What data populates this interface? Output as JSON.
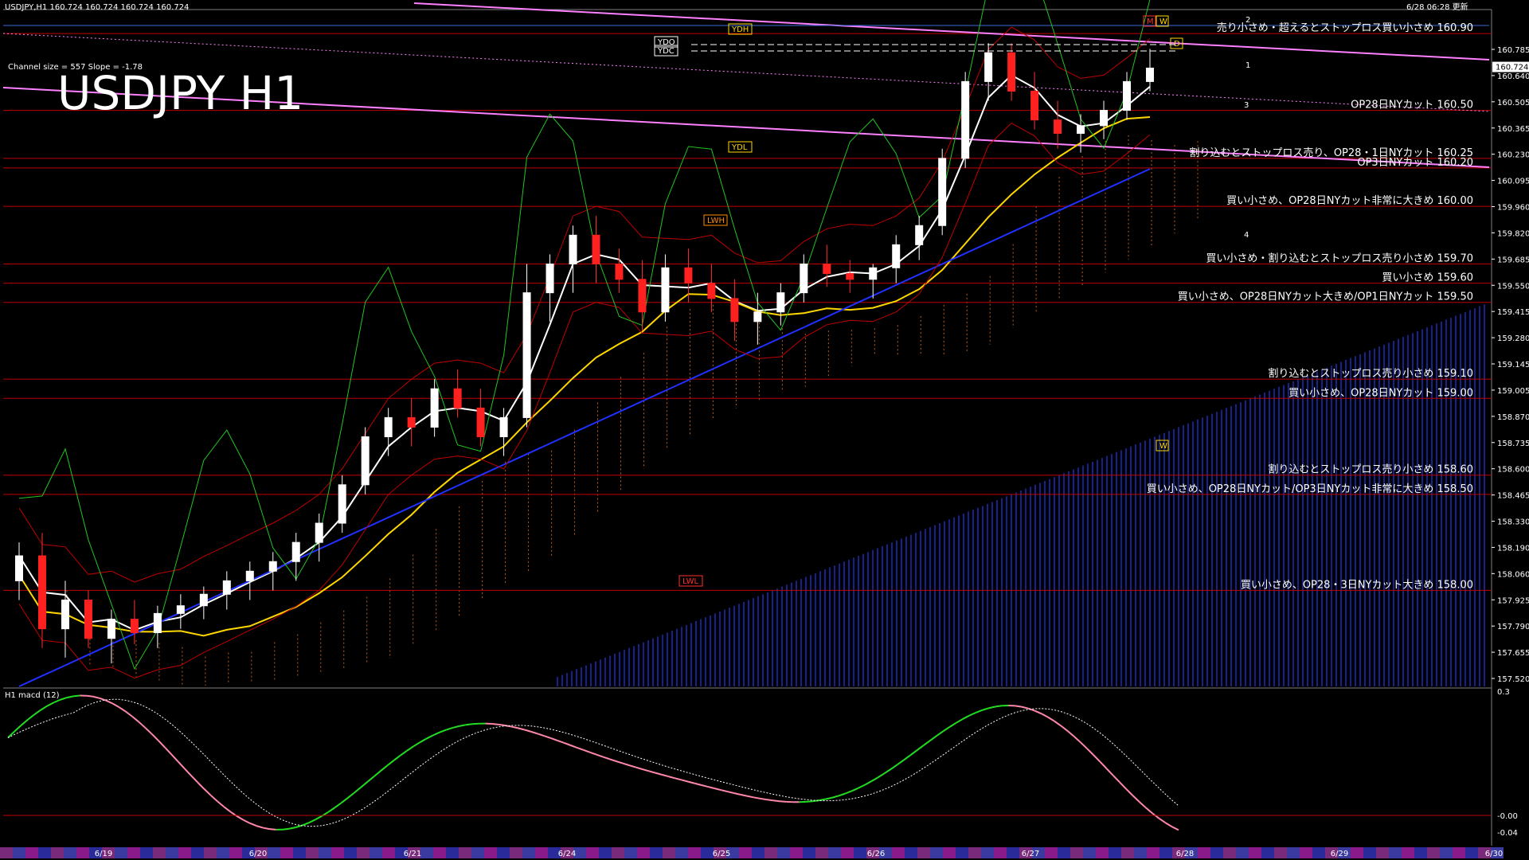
{
  "header": {
    "symbol_line": "USDJPY,H1  160.724 160.724 160.724 160.724",
    "updated": "6/28 06:28 更新",
    "channel_info": "Channel size = 557 Slope = -1.78",
    "subwindow_label": "H1  macd (12)"
  },
  "chart_data": {
    "type": "candlestick",
    "title": "USDJPY H1",
    "price_axis": {
      "range": [
        157.5,
        161.0
      ],
      "ticks": [
        "160.785",
        "160.640",
        "160.505",
        "160.365",
        "160.230",
        "160.095",
        "159.960",
        "159.820",
        "159.685",
        "159.550",
        "159.415",
        "159.280",
        "159.145",
        "159.005",
        "158.870",
        "158.735",
        "158.600",
        "158.465",
        "158.330",
        "158.190",
        "158.060",
        "157.925",
        "157.790",
        "157.655",
        "157.520"
      ],
      "current_price": "160.724"
    },
    "macd_axis": {
      "range": [
        -0.05,
        0.3
      ],
      "ticks": [
        "0.3",
        "-0.00",
        "-0.04"
      ]
    },
    "date_labels": [
      "6/19",
      "6/20",
      "6/21",
      "6/24",
      "6/25",
      "6/26",
      "6/27",
      "6/28",
      "6/29",
      "6/30"
    ],
    "level_labels": [
      "YDH",
      "YDL",
      "YDO",
      "YDC",
      "LWH",
      "LWL",
      "M",
      "W",
      "D",
      "W",
      "1",
      "2",
      "3",
      "4"
    ],
    "price_levels": [
      {
        "price": 160.9,
        "text": "売り小さめ・超えるとストップロス買い小さめ 160.90"
      },
      {
        "price": 160.5,
        "text": "OP28日NYカット 160.50"
      },
      {
        "price": 160.25,
        "text": "割り込むとストップロス売り、OP28・1日NYカット 160.25"
      },
      {
        "price": 160.2,
        "text": "OP3日NYカット 160.20"
      },
      {
        "price": 160.0,
        "text": "買い小さめ、OP28日NYカット非常に大きめ 160.00"
      },
      {
        "price": 159.7,
        "text": "買い小さめ・割り込むとストップロス売り小さめ 159.70"
      },
      {
        "price": 159.6,
        "text": "買い小さめ 159.60"
      },
      {
        "price": 159.5,
        "text": "買い小さめ、OP28日NYカット大きめ/OP1日NYカット 159.50"
      },
      {
        "price": 159.1,
        "text": "割り込むとストップロス売り小さめ 159.10"
      },
      {
        "price": 159.0,
        "text": "買い小さめ、OP28日NYカット 159.00"
      },
      {
        "price": 158.6,
        "text": "割り込むとストップロス売り小さめ 158.60"
      },
      {
        "price": 158.5,
        "text": "買い小さめ、OP28日NYカット/OP3日NYカット非常に大きめ 158.50"
      },
      {
        "price": 158.0,
        "text": "買い小さめ、OP28・3日NYカット大きめ 158.00"
      }
    ],
    "candles": [
      [
        158.05,
        158.25,
        157.95,
        158.18
      ],
      [
        158.18,
        158.3,
        157.7,
        157.8
      ],
      [
        157.8,
        158.05,
        157.65,
        157.95
      ],
      [
        157.95,
        158.0,
        157.7,
        157.75
      ],
      [
        157.75,
        157.9,
        157.62,
        157.85
      ],
      [
        157.85,
        157.95,
        157.72,
        157.78
      ],
      [
        157.78,
        157.92,
        157.7,
        157.88
      ],
      [
        157.88,
        157.98,
        157.8,
        157.92
      ],
      [
        157.92,
        158.02,
        157.85,
        157.98
      ],
      [
        157.98,
        158.1,
        157.9,
        158.05
      ],
      [
        158.05,
        158.15,
        157.95,
        158.1
      ],
      [
        158.1,
        158.2,
        158.0,
        158.15
      ],
      [
        158.15,
        158.3,
        158.05,
        158.25
      ],
      [
        158.25,
        158.4,
        158.15,
        158.35
      ],
      [
        158.35,
        158.6,
        158.3,
        158.55
      ],
      [
        158.55,
        158.85,
        158.5,
        158.8
      ],
      [
        158.8,
        158.95,
        158.7,
        158.9
      ],
      [
        158.9,
        159.0,
        158.75,
        158.85
      ],
      [
        158.85,
        159.1,
        158.8,
        159.05
      ],
      [
        159.05,
        159.15,
        158.9,
        158.95
      ],
      [
        158.95,
        159.05,
        158.75,
        158.8
      ],
      [
        158.8,
        158.95,
        158.7,
        158.9
      ],
      [
        158.9,
        159.7,
        158.85,
        159.55
      ],
      [
        159.55,
        159.75,
        159.4,
        159.7
      ],
      [
        159.7,
        159.9,
        159.55,
        159.85
      ],
      [
        159.85,
        159.95,
        159.6,
        159.7
      ],
      [
        159.7,
        159.78,
        159.55,
        159.62
      ],
      [
        159.62,
        159.72,
        159.35,
        159.45
      ],
      [
        159.45,
        159.75,
        159.4,
        159.68
      ],
      [
        159.68,
        159.78,
        159.5,
        159.6
      ],
      [
        159.6,
        159.7,
        159.45,
        159.52
      ],
      [
        159.52,
        159.62,
        159.3,
        159.4
      ],
      [
        159.4,
        159.55,
        159.28,
        159.45
      ],
      [
        159.45,
        159.6,
        159.38,
        159.55
      ],
      [
        159.55,
        159.75,
        159.5,
        159.7
      ],
      [
        159.7,
        159.8,
        159.58,
        159.65
      ],
      [
        159.65,
        159.72,
        159.55,
        159.62
      ],
      [
        159.62,
        159.7,
        159.52,
        159.68
      ],
      [
        159.68,
        159.85,
        159.6,
        159.8
      ],
      [
        159.8,
        159.95,
        159.72,
        159.9
      ],
      [
        159.9,
        160.3,
        159.85,
        160.25
      ],
      [
        160.25,
        160.7,
        160.2,
        160.65
      ],
      [
        160.65,
        160.85,
        160.55,
        160.8
      ],
      [
        160.8,
        160.85,
        160.55,
        160.6
      ],
      [
        160.6,
        160.7,
        160.4,
        160.45
      ],
      [
        160.45,
        160.55,
        160.3,
        160.38
      ],
      [
        160.38,
        160.48,
        160.28,
        160.42
      ],
      [
        160.42,
        160.55,
        160.35,
        160.5
      ],
      [
        160.5,
        160.7,
        160.45,
        160.65
      ],
      [
        160.65,
        160.82,
        160.6,
        160.72
      ]
    ]
  },
  "colors": {
    "background": "#000000",
    "grid_red": "#c00000",
    "ma_white": "#ffffff",
    "ma_yellow": "#ffd700",
    "ma_blue": "#2030ff",
    "channel": "#ff80ff",
    "band_green": "#22c422",
    "cloud": "#d2691e"
  }
}
